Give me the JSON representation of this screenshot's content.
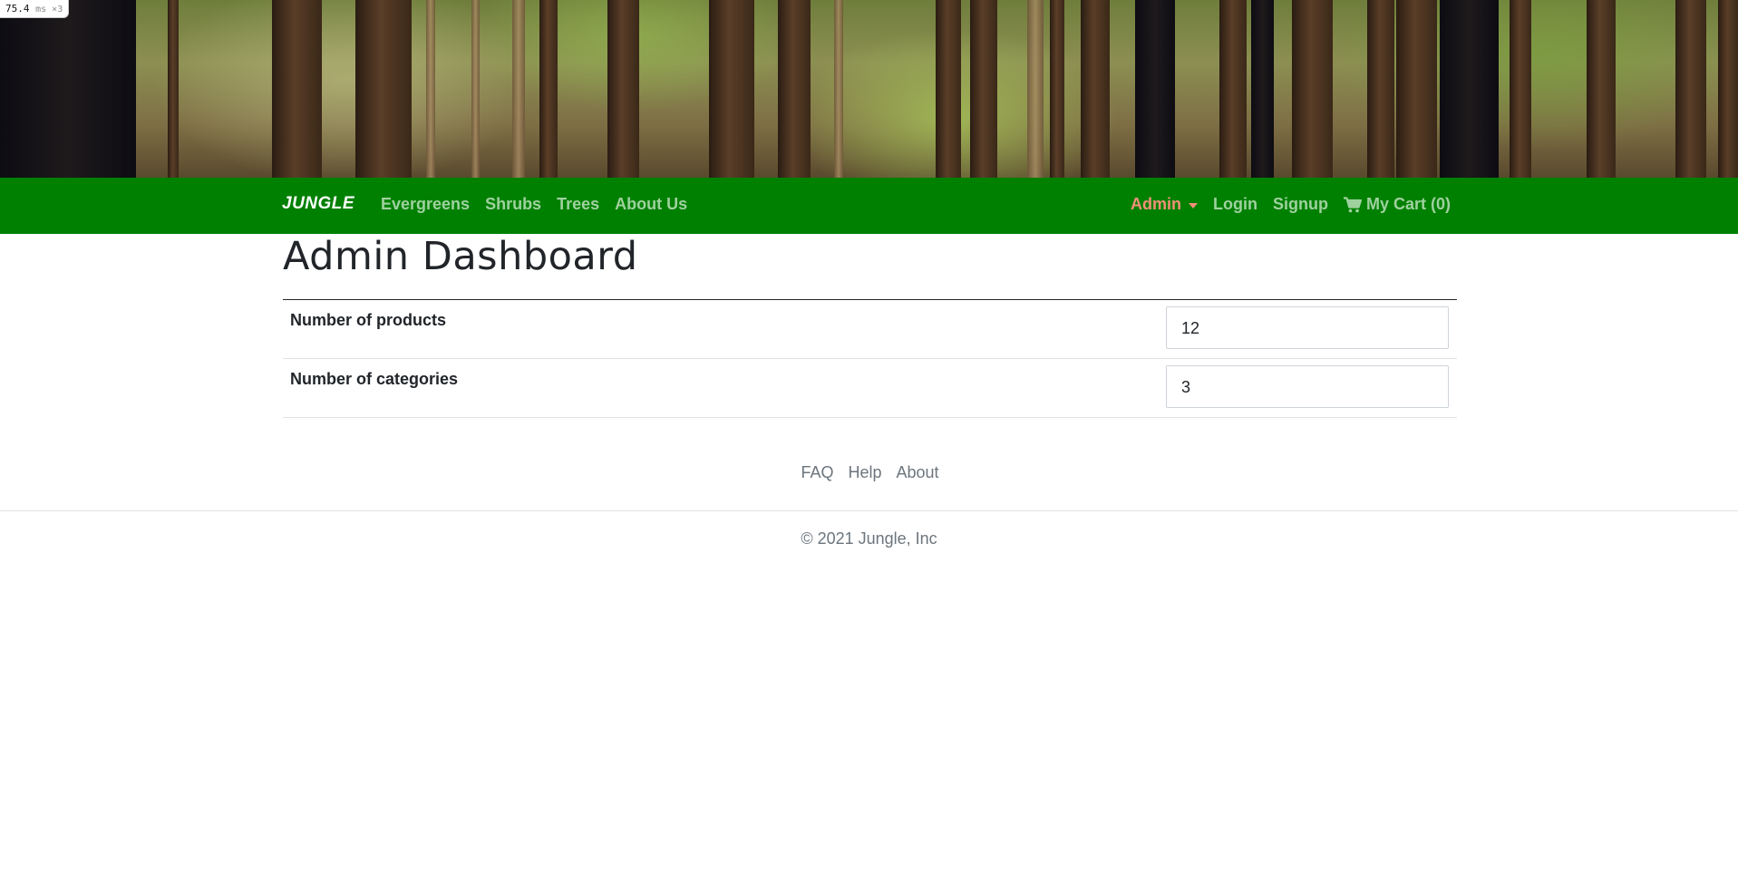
{
  "perf_badge": {
    "value": "75.4",
    "unit": "ms ×3"
  },
  "hero": {
    "image": "forest-banner"
  },
  "navbar": {
    "brand": "JUNGLE",
    "left_links": [
      "Evergreens",
      "Shrubs",
      "Trees",
      "About Us"
    ],
    "admin_label": "Admin",
    "login_label": "Login",
    "signup_label": "Signup",
    "cart_label": "My Cart (0)",
    "cart_icon": "shopping-cart-icon",
    "background_color": "#008000",
    "link_color": "#9fd19f",
    "admin_color": "#f0907a"
  },
  "main": {
    "title": "Admin Dashboard",
    "stats": [
      {
        "label": "Number of products",
        "value": "12"
      },
      {
        "label": "Number of categories",
        "value": "3"
      }
    ]
  },
  "footer": {
    "links": [
      "FAQ",
      "Help",
      "About"
    ],
    "copyright": "© 2021 Jungle, Inc"
  }
}
